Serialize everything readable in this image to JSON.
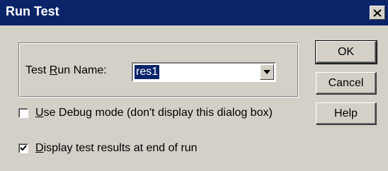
{
  "window": {
    "title": "Run Test",
    "close_icon": "close-icon"
  },
  "run_name": {
    "label_prefix": "Test ",
    "label_accel": "R",
    "label_suffix": "un Name:",
    "value": "res1",
    "dropdown_icon": "chevron-down-icon"
  },
  "buttons": {
    "ok": "OK",
    "cancel": "Cancel",
    "help": "Help"
  },
  "options": {
    "debug": {
      "accel": "U",
      "label": "se Debug mode (don't display this dialog box)",
      "checked": false
    },
    "display_results": {
      "accel": "D",
      "label": "isplay test results at end of run",
      "checked": true
    }
  }
}
